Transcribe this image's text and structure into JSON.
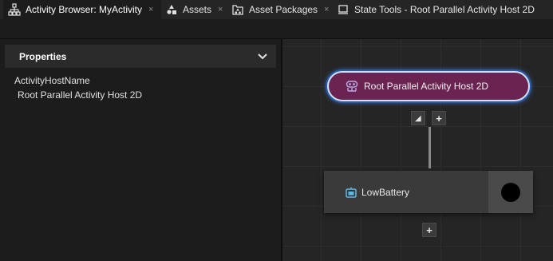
{
  "tabs": [
    {
      "label": "Activity Browser: MyActivity",
      "icon": "activity-tree-icon",
      "active": true
    },
    {
      "label": "Assets",
      "icon": "assets-icon",
      "active": false
    },
    {
      "label": "Asset Packages",
      "icon": "asset-packages-icon",
      "active": false
    },
    {
      "label": "State Tools - Root Parallel Activity Host 2D",
      "icon": "state-tools-icon",
      "active": false
    }
  ],
  "close_glyph": "×",
  "properties": {
    "title": "Properties",
    "expand_icon": "chevron-down-icon",
    "property_name": "ActivityHostName",
    "property_value": "Root Parallel Activity Host 2D"
  },
  "canvas": {
    "root_node": {
      "label": "Root Parallel Activity Host 2D",
      "icon": "parallel-host-icon",
      "selected": true
    },
    "collapse_button": "◢",
    "add_button": "+",
    "child_node": {
      "label": "LowBattery",
      "icon": "activity-icon"
    },
    "child_add_button": "+"
  },
  "colors": {
    "root_node_fill": "#6b2451",
    "selection_outline": "#cfe4ff",
    "canvas_background": "#252525",
    "node_fill": "#3a3a3a"
  }
}
